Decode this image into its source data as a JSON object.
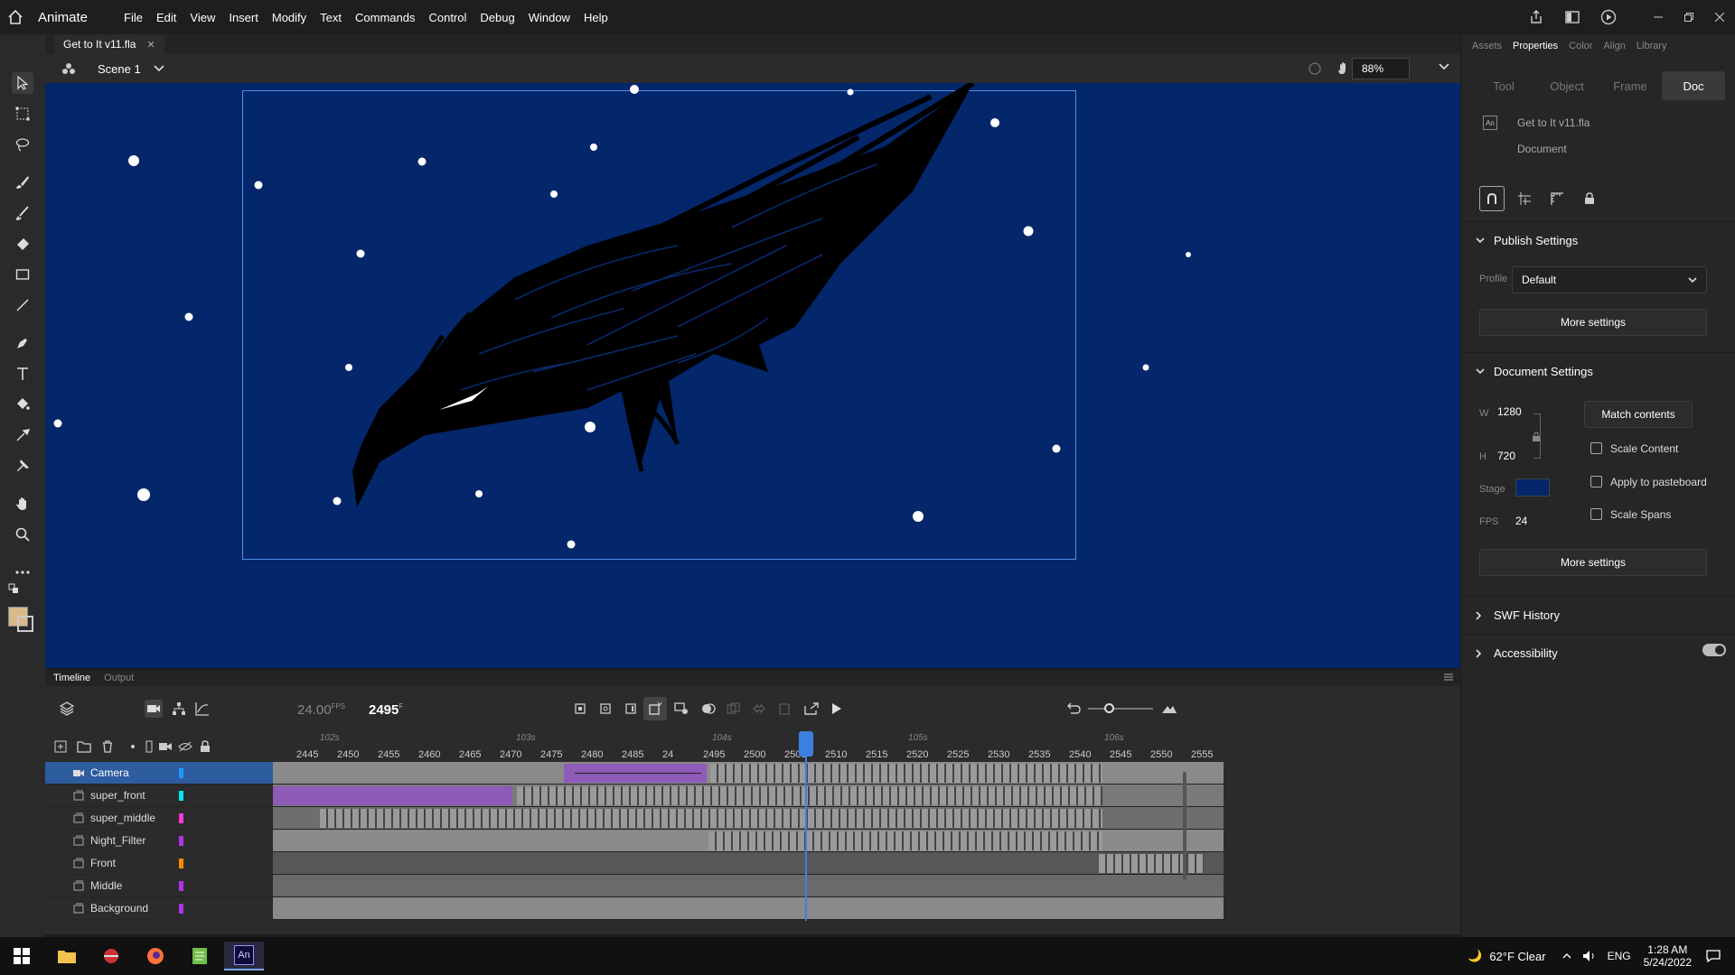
{
  "app": {
    "name": "Animate"
  },
  "menus": [
    "File",
    "Edit",
    "View",
    "Insert",
    "Modify",
    "Text",
    "Commands",
    "Control",
    "Debug",
    "Window",
    "Help"
  ],
  "document": {
    "tab_title": "Get to It v11.fla",
    "scene": "Scene 1",
    "zoom": "88%"
  },
  "bottom_tabs": {
    "timeline": "Timeline",
    "output": "Output"
  },
  "timeline": {
    "fps": "24.00",
    "fps_unit": "FPS",
    "current_frame": "2495",
    "frame_unit": "F",
    "seconds": [
      "102s",
      "103s",
      "104s",
      "105s",
      "106s"
    ],
    "frame_ticks": [
      "2445",
      "2450",
      "2455",
      "2460",
      "2465",
      "2470",
      "2475",
      "2480",
      "2485",
      "24",
      "2495",
      "2500",
      "2505",
      "2510",
      "2515",
      "2520",
      "2525",
      "2530",
      "2535",
      "2540",
      "2545",
      "2550",
      "2555"
    ],
    "layers": [
      {
        "name": "Camera",
        "color": "#1e9bff",
        "active": true
      },
      {
        "name": "super_front",
        "color": "#00e6f0",
        "active": false
      },
      {
        "name": "super_middle",
        "color": "#ff35d8",
        "active": false
      },
      {
        "name": "Night_Filter",
        "color": "#b133e8",
        "active": false
      },
      {
        "name": "Front",
        "color": "#ff8a00",
        "active": false
      },
      {
        "name": "Middle",
        "color": "#b133e8",
        "active": false
      },
      {
        "name": "Background",
        "color": "#b133e8",
        "active": false
      }
    ]
  },
  "properties": {
    "panel_tabs": [
      "Assets",
      "Properties",
      "Color",
      "Align",
      "Library"
    ],
    "sub_tabs": [
      "Tool",
      "Object",
      "Frame",
      "Doc"
    ],
    "doc_name": "Get to It v11.fla",
    "doc_type": "Document",
    "publish_settings": {
      "title": "Publish Settings",
      "profile_label": "Profile",
      "profile": "Default",
      "more": "More settings"
    },
    "document_settings": {
      "title": "Document Settings",
      "w_label": "W",
      "w": "1280",
      "h_label": "H",
      "h": "720",
      "stage_label": "Stage",
      "fps_label": "FPS",
      "fps": "24",
      "match_contents": "Match contents",
      "scale_content": "Scale Content",
      "apply_pasteboard": "Apply to pasteboard",
      "scale_spans": "Scale Spans",
      "more": "More settings"
    },
    "swf_history": "SWF History",
    "accessibility": "Accessibility"
  },
  "taskbar": {
    "weather": "62°F  Clear",
    "lang": "ENG",
    "time": "1:28 AM",
    "date": "5/24/2022"
  },
  "colors": {
    "stage_bg": "#04266a",
    "accent": "#3d7fe0",
    "tween": "#8e5bb8",
    "fill_swatch": "#d9b98b"
  }
}
